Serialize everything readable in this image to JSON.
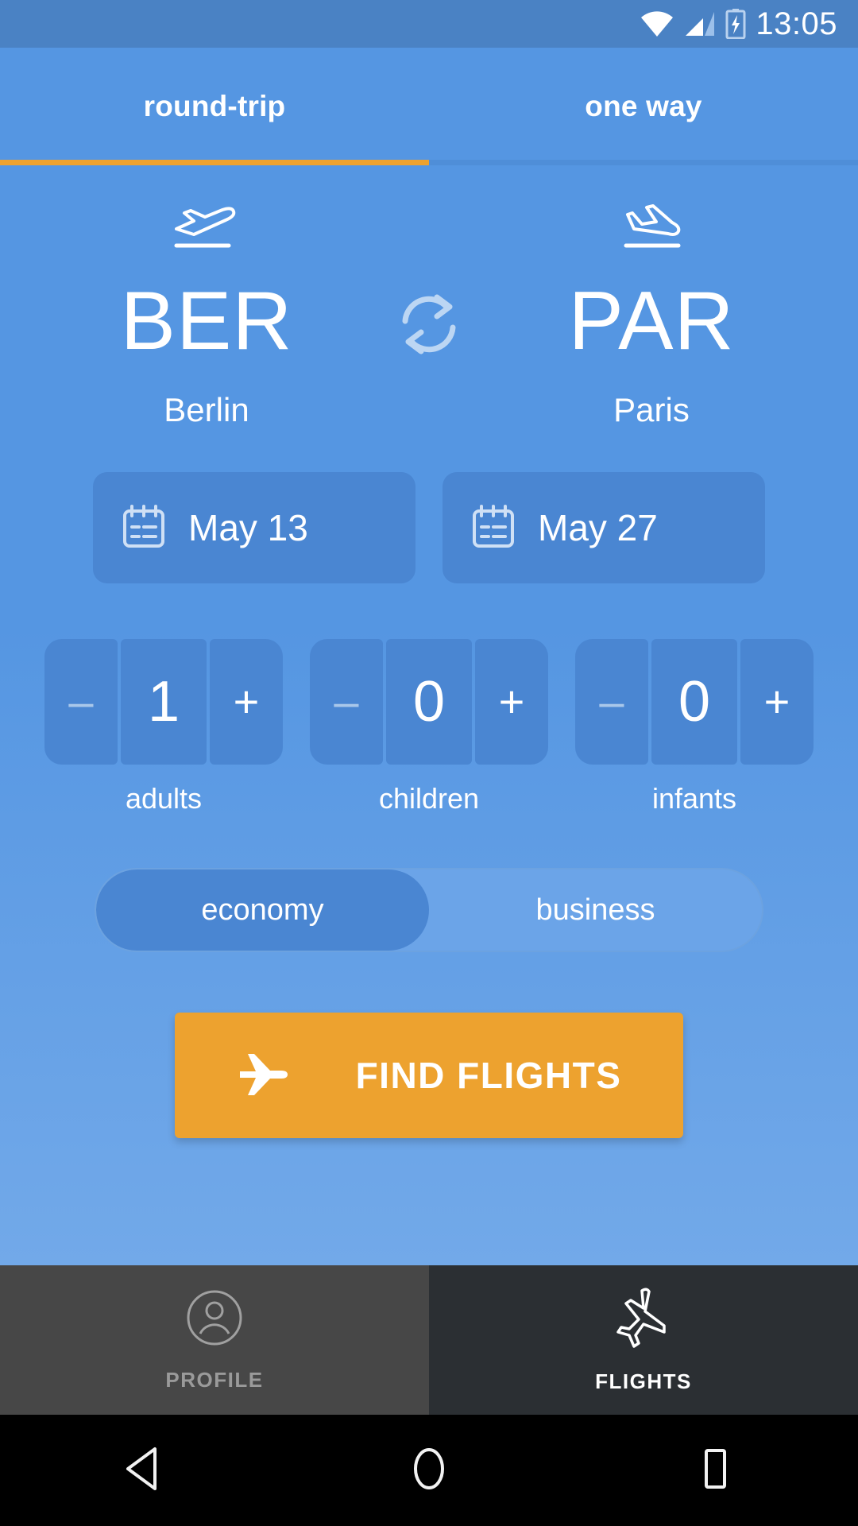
{
  "statusbar": {
    "time": "13:05",
    "icons": [
      "wifi-icon",
      "cellular-signal-icon",
      "battery-charging-icon"
    ]
  },
  "tabs": {
    "items": [
      {
        "label": "round-trip",
        "active": true
      },
      {
        "label": "one way",
        "active": false
      }
    ],
    "indicator_color": "#eda22f"
  },
  "route": {
    "origin": {
      "icon": "flight-takeoff-icon",
      "code": "BER",
      "city": "Berlin"
    },
    "destination": {
      "icon": "flight-land-icon",
      "code": "PAR",
      "city": "Paris"
    },
    "swap_icon": "swap-arrows-icon"
  },
  "dates": {
    "depart": {
      "icon": "calendar-icon",
      "value": "May 13"
    },
    "return": {
      "icon": "calendar-icon",
      "value": "May 27"
    }
  },
  "passengers": [
    {
      "label": "adults",
      "value": "1",
      "minus": "–",
      "plus": "+"
    },
    {
      "label": "children",
      "value": "0",
      "minus": "–",
      "plus": "+"
    },
    {
      "label": "infants",
      "value": "0",
      "minus": "–",
      "plus": "+"
    }
  ],
  "cabin_class": {
    "options": [
      "economy",
      "business"
    ],
    "selected": "economy"
  },
  "cta": {
    "label": "FIND FLIGHTS",
    "icon": "airplane-icon",
    "color": "#eda22f"
  },
  "bottom_nav": [
    {
      "label": "PROFILE",
      "icon": "person-circle-icon",
      "active": false
    },
    {
      "label": "FLIGHTS",
      "icon": "airplane-outline-icon",
      "active": true
    }
  ],
  "android_nav": {
    "back": "back-triangle-icon",
    "home": "home-circle-icon",
    "recents": "recents-square-icon"
  },
  "colors": {
    "primary_blue": "#5596e2",
    "status_blue": "#4a82c4",
    "field_blue": "#4a86d2",
    "accent_orange": "#eda22f"
  }
}
